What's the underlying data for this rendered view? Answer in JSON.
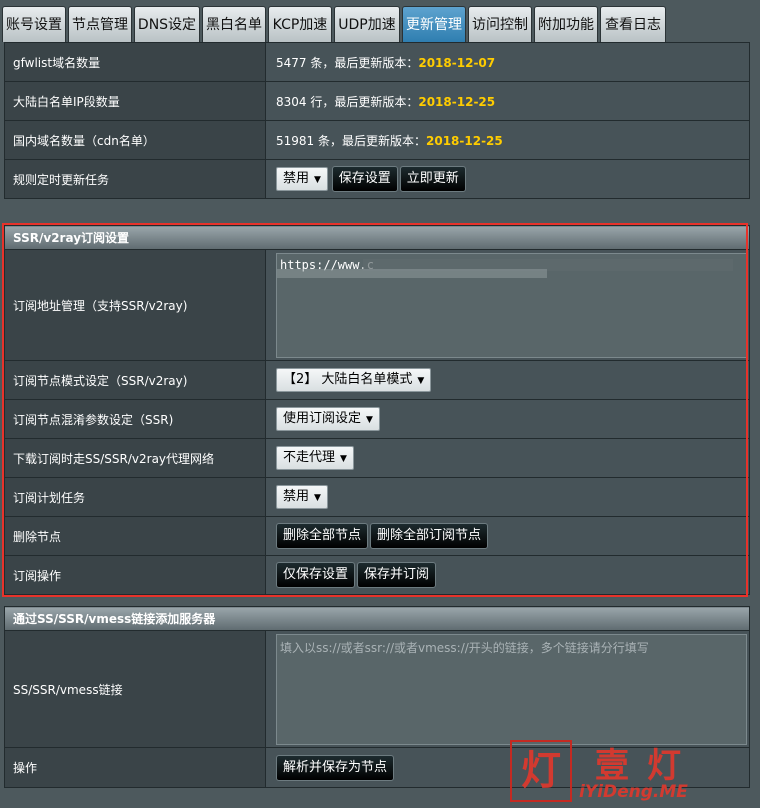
{
  "tabs": [
    {
      "label": "账号设置",
      "active": false
    },
    {
      "label": "节点管理",
      "active": false
    },
    {
      "label": "DNS设定",
      "active": false
    },
    {
      "label": "黑白名单",
      "active": false
    },
    {
      "label": "KCP加速",
      "active": false
    },
    {
      "label": "UDP加速",
      "active": false
    },
    {
      "label": "更新管理",
      "active": true
    },
    {
      "label": "访问控制",
      "active": false
    },
    {
      "label": "附加功能",
      "active": false
    },
    {
      "label": "查看日志",
      "active": false
    }
  ],
  "rules": {
    "gfwlist": {
      "label": "gfwlist域名数量",
      "count": "5477 条，最后更新版本：",
      "date": "2018-12-07"
    },
    "chnroute": {
      "label": "大陆白名单IP段数量",
      "count": "8304 行，最后更新版本：",
      "date": "2018-12-25"
    },
    "cdn": {
      "label": "国内域名数量（cdn名单）",
      "count": "51981 条，最后更新版本：",
      "date": "2018-12-25"
    },
    "schedule": {
      "label": "规则定时更新任务",
      "select": "禁用",
      "save": "保存设置",
      "update_now": "立即更新"
    }
  },
  "subscribe": {
    "title": "SSR/v2ray订阅设置",
    "url_label": "订阅地址管理（支持SSR/v2ray)",
    "url_value": "https://www.c",
    "mode_label": "订阅节点模式设定（SSR/v2ray)",
    "mode_value": "【2】 大陆白名单模式",
    "obfs_label": "订阅节点混淆参数设定（SSR)",
    "obfs_value": "使用订阅设定",
    "proxy_label": "下载订阅时走SS/SSR/v2ray代理网络",
    "proxy_value": "不走代理",
    "plan_label": "订阅计划任务",
    "plan_value": "禁用",
    "delete_label": "删除节点",
    "delete_all": "删除全部节点",
    "delete_sub": "删除全部订阅节点",
    "op_label": "订阅操作",
    "save_only": "仅保存设置",
    "save_sub": "保存并订阅"
  },
  "links": {
    "title": "通过SS/SSR/vmess链接添加服务器",
    "link_label": "SS/SSR/vmess链接",
    "placeholder": "填入以ss://或者ssr://或者vmess://开头的链接，多个链接请分行填写",
    "op_label": "操作",
    "parse_btn": "解析并保存为节点"
  },
  "watermark": {
    "box": "灯",
    "text": "壹灯",
    "url": "iYiDeng.ME"
  },
  "colors": {
    "date": "#ffcc00",
    "highlight": "#e8322a",
    "active_tab": "#3a8bc0"
  }
}
